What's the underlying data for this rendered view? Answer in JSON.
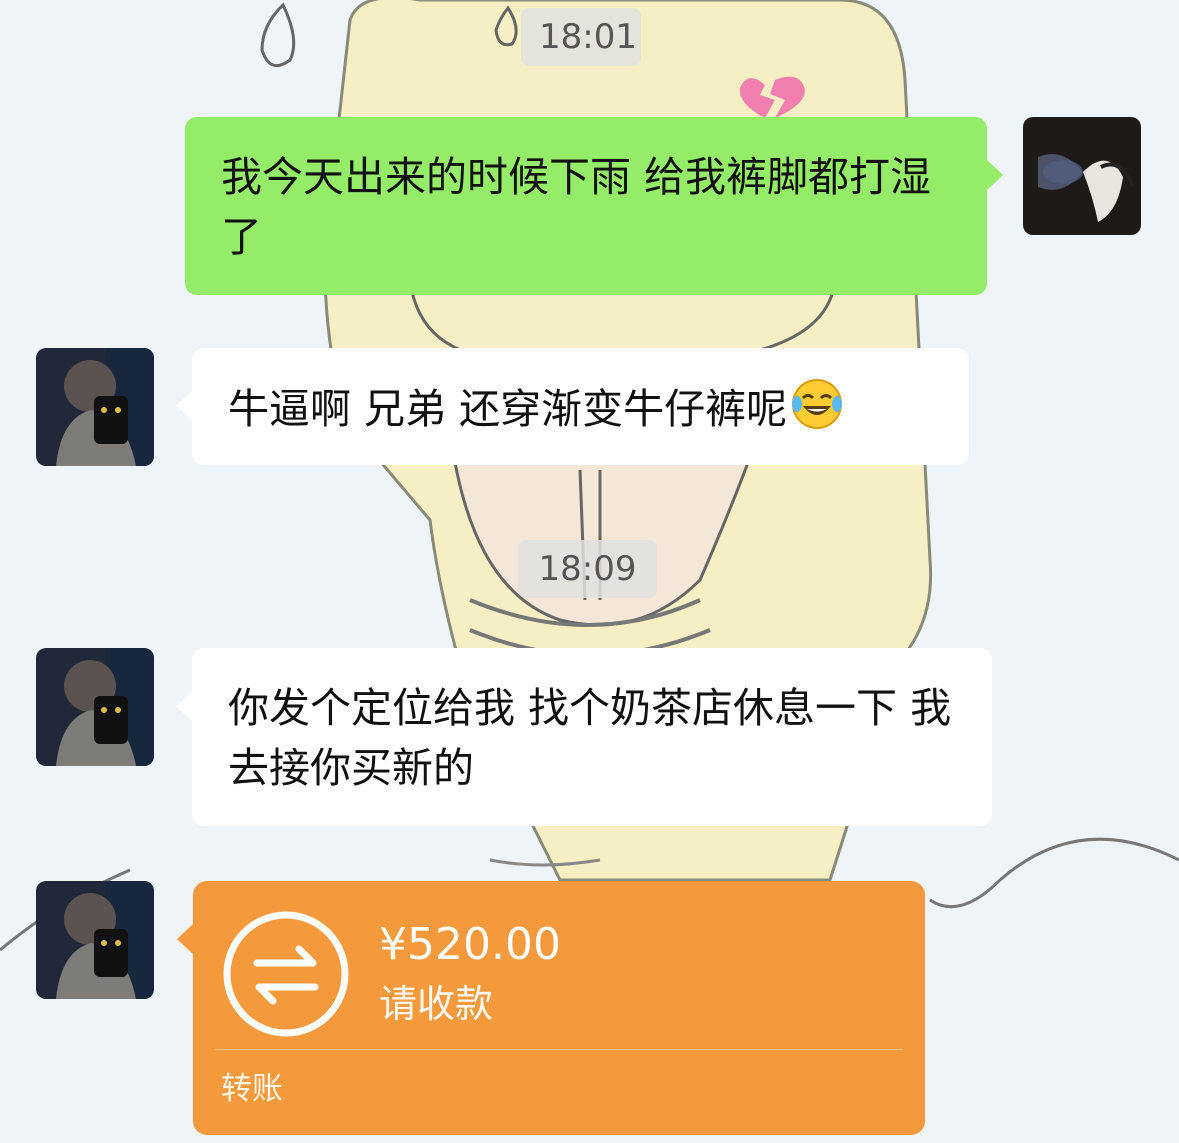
{
  "messages": {
    "ts1": "18:01",
    "ts2": "18:09",
    "m1": "我今天出来的时候下雨 给我裤脚都打湿了",
    "m2": "牛逼啊 兄弟 还穿渐变牛仔裤呢",
    "m3": "你发个定位给我 找个奶茶店休息一下 我去接你买新的"
  },
  "transfer": {
    "amount": "¥520.00",
    "status": "请收款",
    "label": "转账"
  },
  "icons": {
    "emoji": "laughing-tears-icon",
    "transfer": "transfer-arrows-icon"
  },
  "colors": {
    "outgoing_bubble": "#95ec69",
    "incoming_bubble": "#ffffff",
    "transfer_card": "#f59a3c"
  }
}
